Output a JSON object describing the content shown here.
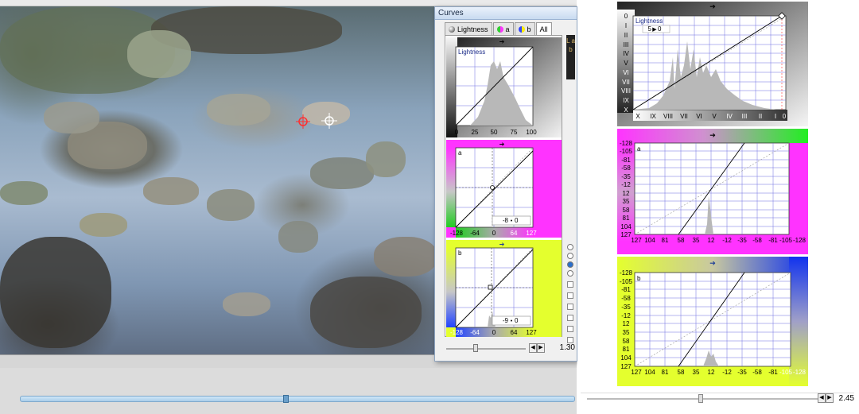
{
  "curves_window": {
    "title": "Curves",
    "tabs": [
      {
        "label": "Lightness",
        "icon": "lightness-icon"
      },
      {
        "label": "a",
        "icon": "a-channel-icon"
      },
      {
        "label": "b",
        "icon": "b-channel-icon"
      },
      {
        "label": "All",
        "icon": ""
      }
    ],
    "active_tab": "All",
    "side_label": "L a b",
    "zoom": "1.30",
    "lightness": {
      "label": "Lightness",
      "ticks": [
        "0",
        "25",
        "50",
        "75",
        "100"
      ]
    },
    "a": {
      "label": "a",
      "ticks": [
        "-128",
        "-64",
        "0",
        "64",
        "127"
      ],
      "readout_in": "-8",
      "readout_out": "0"
    },
    "b": {
      "label": "b",
      "ticks": [
        "-128",
        "-64",
        "0",
        "64",
        "127"
      ],
      "readout_in": "-9",
      "readout_out": "0"
    }
  },
  "right_pane": {
    "zoom": "2.45",
    "lightness": {
      "label": "Lightness",
      "readout_in": "5",
      "readout_out": "0",
      "y_ticks": [
        "0",
        "I",
        "II",
        "III",
        "IV",
        "V",
        "VI",
        "VII",
        "VIII",
        "IX",
        "X"
      ],
      "x_ticks": [
        "X",
        "IX",
        "VIII",
        "VII",
        "VI",
        "V",
        "IV",
        "III",
        "II",
        "I",
        "0"
      ]
    },
    "a": {
      "label": "a",
      "y_ticks": [
        "-128",
        "-105",
        "-81",
        "-58",
        "-35",
        "-12",
        "12",
        "35",
        "58",
        "81",
        "104",
        "127"
      ],
      "x_ticks": [
        "127",
        "104",
        "81",
        "58",
        "35",
        "12",
        "-12",
        "-35",
        "-58",
        "-81",
        "-105",
        "-128"
      ]
    },
    "b": {
      "label": "b",
      "y_ticks": [
        "-128",
        "-105",
        "-81",
        "-58",
        "-35",
        "-12",
        "12",
        "35",
        "58",
        "81",
        "104",
        "127"
      ],
      "x_ticks": [
        "127",
        "104",
        "81",
        "58",
        "35",
        "12",
        "-12",
        "-35",
        "-58",
        "-81",
        "-105",
        "-128"
      ]
    }
  },
  "colors": {
    "a_border": "#ff2bff",
    "b_border": "#e4ff2e",
    "grid": "#6f6fe0",
    "histogram": "#b8b8b8"
  }
}
